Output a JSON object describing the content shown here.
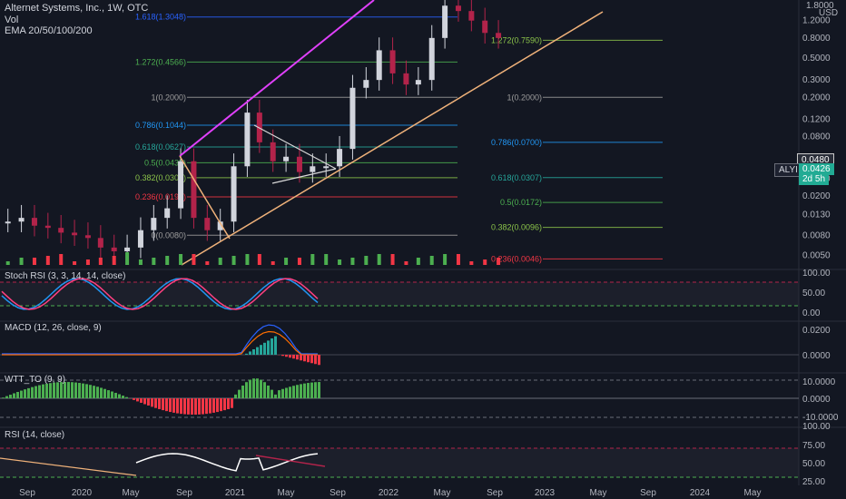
{
  "header": {
    "title": "Alternet Systems, Inc., 1W, OTC",
    "vol": "Vol",
    "ema": "EMA 20/50/100/200"
  },
  "price_axis": {
    "currency": "USD",
    "ticks": [
      "1.2000",
      "0.8000",
      "0.5000",
      "0.3000",
      "0.2000",
      "0.1200",
      "0.0800",
      "0.0300",
      "0.0200",
      "0.0130",
      "0.0080",
      "0.0050"
    ],
    "top_partial": "1.8000"
  },
  "badges": {
    "price_box": "0.0480",
    "symbol": "ALYI",
    "last_price": "0.0426",
    "countdown": "2d 5h"
  },
  "colors": {
    "background": "#131722",
    "up": "#d1d4dc",
    "down": "#b2234a",
    "volume_up": "#4caf50",
    "volume_down": "#f23645",
    "channel_upper": "#e040fb",
    "channel_lower": "#f0b27a",
    "wedge": "#d8d8d8",
    "stoch_k": "#2196f3",
    "stoch_d": "#ff4081",
    "macd": "#2962ff",
    "signal": "#ff6d00",
    "wtt_pos": "#4caf50",
    "wtt_neg": "#f23645"
  },
  "chart_data": [
    {
      "type": "line",
      "panel": "price",
      "title": "Alternet Systems, Inc., 1W, OTC",
      "scale": "log",
      "ylim": [
        0.004,
        1.9
      ],
      "fib_left": [
        {
          "label": "1.618(1.3048)",
          "value": 1.3048,
          "color": "#2962ff"
        },
        {
          "label": "1.272(0.4566)",
          "value": 0.4566,
          "color": "#4caf50"
        },
        {
          "label": "1(0.2000)",
          "value": 0.2,
          "color": "#9e9e9e"
        },
        {
          "label": "0.786(0.1044)",
          "value": 0.1044,
          "color": "#2196f3"
        },
        {
          "label": "0.618(0.0627)",
          "value": 0.0627,
          "color": "#26a69a"
        },
        {
          "label": "0.5(0.0435)",
          "value": 0.0435,
          "color": "#4caf50"
        },
        {
          "label": "0.382(0.0306)",
          "value": 0.0306,
          "color": "#8bc34a"
        },
        {
          "label": "0.236(0.0196)",
          "value": 0.0196,
          "color": "#f23645"
        },
        {
          "label": "0(0.0080)",
          "value": 0.008,
          "color": "#9e9e9e"
        }
      ],
      "fib_right": [
        {
          "label": "1.272(0.7590)",
          "value": 0.759,
          "color": "#8bc34a"
        },
        {
          "label": "1(0.2000)",
          "value": 0.2,
          "color": "#9e9e9e"
        },
        {
          "label": "0.786(0.0700)",
          "value": 0.07,
          "color": "#2196f3"
        },
        {
          "label": "0.618(0.0307)",
          "value": 0.0307,
          "color": "#26a69a"
        },
        {
          "label": "0.5(0.0172)",
          "value": 0.0172,
          "color": "#4caf50"
        },
        {
          "label": "0.382(0.0096)",
          "value": 0.0096,
          "color": "#8bc34a"
        },
        {
          "label": "0.236(0.0046)",
          "value": 0.0046,
          "color": "#f23645"
        }
      ],
      "price_series": [
        {
          "date": "2019-08",
          "v": 0.011
        },
        {
          "date": "2019-09",
          "v": 0.012
        },
        {
          "date": "2019-10",
          "v": 0.01
        },
        {
          "date": "2019-11",
          "v": 0.0095
        },
        {
          "date": "2019-12",
          "v": 0.0085
        },
        {
          "date": "2020-01",
          "v": 0.008
        },
        {
          "date": "2020-02",
          "v": 0.0075
        },
        {
          "date": "2020-03",
          "v": 0.006
        },
        {
          "date": "2020-04",
          "v": 0.0055
        },
        {
          "date": "2020-05",
          "v": 0.006
        },
        {
          "date": "2020-06",
          "v": 0.009
        },
        {
          "date": "2020-07",
          "v": 0.012
        },
        {
          "date": "2020-08",
          "v": 0.015
        },
        {
          "date": "2020-09",
          "v": 0.045
        },
        {
          "date": "2020-10",
          "v": 0.012
        },
        {
          "date": "2020-11",
          "v": 0.009
        },
        {
          "date": "2020-12",
          "v": 0.011
        },
        {
          "date": "2021-01",
          "v": 0.04
        },
        {
          "date": "2021-02",
          "v": 0.14
        },
        {
          "date": "2021-03",
          "v": 0.07
        },
        {
          "date": "2021-04",
          "v": 0.045
        },
        {
          "date": "2021-05",
          "v": 0.05
        },
        {
          "date": "2021-06",
          "v": 0.035
        },
        {
          "date": "2021-07",
          "v": 0.04
        },
        {
          "date": "2021-08",
          "v": 0.04
        },
        {
          "date": "2021-09",
          "v": 0.06
        },
        {
          "date": "2021-10",
          "v": 0.25
        },
        {
          "date": "2021-11",
          "v": 0.3
        },
        {
          "date": "2021-12",
          "v": 0.6
        },
        {
          "date": "2022-01",
          "v": 0.35
        },
        {
          "date": "2022-02",
          "v": 0.27
        },
        {
          "date": "2022-03",
          "v": 0.3
        },
        {
          "date": "2022-04",
          "v": 0.8
        },
        {
          "date": "2022-05",
          "v": 1.7
        },
        {
          "date": "2022-06",
          "v": 1.5
        },
        {
          "date": "2022-07",
          "v": 1.2
        },
        {
          "date": "2022-08",
          "v": 0.9
        },
        {
          "date": "2022-09",
          "v": 0.8
        }
      ]
    },
    {
      "type": "line",
      "panel": "stoch_rsi",
      "title": "Stoch RSI (3, 3, 14, 14, close)",
      "ylim": [
        0,
        100
      ],
      "ticks": [
        "100.00",
        "50.00",
        "0.00"
      ]
    },
    {
      "type": "line",
      "panel": "macd",
      "title": "MACD (12, 26, close, 9)",
      "ticks": [
        "0.0200",
        "0.0000"
      ]
    },
    {
      "type": "bar",
      "panel": "wtt_to",
      "title": "WTT_TO (9, 9)",
      "ticks": [
        "10.0000",
        "0.0000",
        "-10.0000"
      ]
    },
    {
      "type": "line",
      "panel": "rsi",
      "title": "RSI (14, close)",
      "ylim": [
        20,
        100
      ],
      "ticks": [
        "100.00",
        "75.00",
        "50.00",
        "25.00"
      ]
    }
  ],
  "x_axis": {
    "labels": [
      "Sep",
      "2020",
      "May",
      "Sep",
      "2021",
      "May",
      "Sep",
      "2022",
      "May",
      "Sep",
      "2023",
      "May",
      "Sep",
      "2024",
      "May"
    ]
  }
}
